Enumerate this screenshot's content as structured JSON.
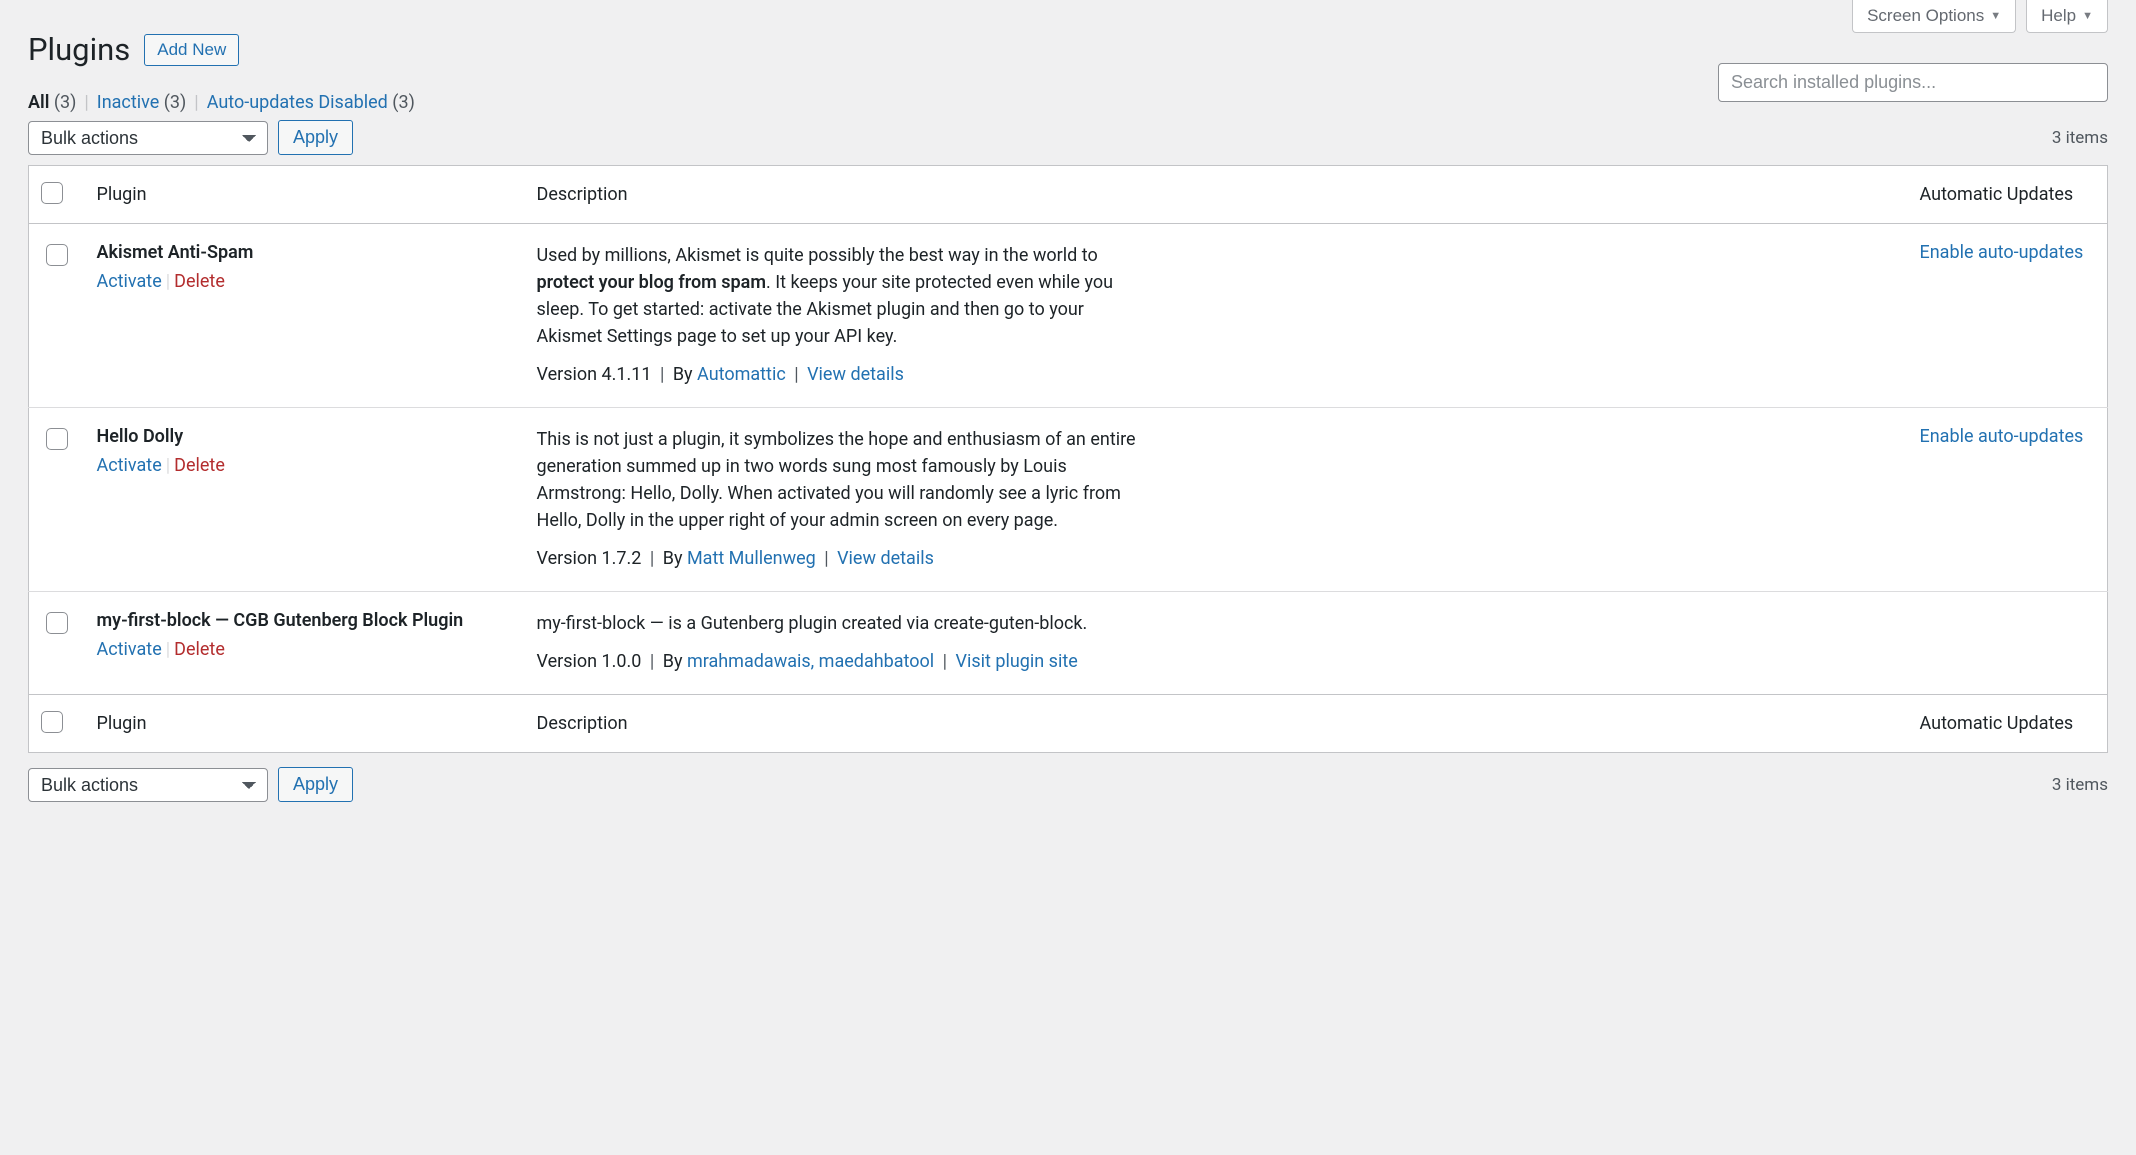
{
  "top_toolbar": {
    "screen_options": "Screen Options",
    "help": "Help"
  },
  "header": {
    "title": "Plugins",
    "add_new": "Add New"
  },
  "filters": {
    "all_label": "All",
    "all_count": "(3)",
    "inactive_label": "Inactive",
    "inactive_count": "(3)",
    "auto_disabled_label": "Auto-updates Disabled",
    "auto_disabled_count": "(3)"
  },
  "search": {
    "placeholder": "Search installed plugins..."
  },
  "bulk": {
    "label": "Bulk actions",
    "apply": "Apply"
  },
  "pagination": {
    "items": "3 items"
  },
  "columns": {
    "plugin": "Plugin",
    "description": "Description",
    "auto_updates": "Automatic Updates"
  },
  "row_labels": {
    "activate": "Activate",
    "delete": "Delete",
    "by": "By",
    "view_details": "View details",
    "visit_plugin_site": "Visit plugin site",
    "enable_auto_updates": "Enable auto-updates"
  },
  "plugins": [
    {
      "name": "Akismet Anti-Spam",
      "desc_pre": "Used by millions, Akismet is quite possibly the best way in the world to ",
      "desc_bold": "protect your blog from spam",
      "desc_post": ". It keeps your site protected even while you sleep. To get started: activate the Akismet plugin and then go to your Akismet Settings page to set up your API key.",
      "version": "Version 4.1.11",
      "author": "Automattic",
      "detail_link": "View details",
      "auto_update": true
    },
    {
      "name": "Hello Dolly",
      "desc_pre": "This is not just a plugin, it symbolizes the hope and enthusiasm of an entire generation summed up in two words sung most famously by Louis Armstrong: Hello, Dolly. When activated you will randomly see a lyric from Hello, Dolly in the upper right of your admin screen on every page.",
      "desc_bold": "",
      "desc_post": "",
      "version": "Version 1.7.2",
      "author": "Matt Mullenweg",
      "detail_link": "View details",
      "auto_update": true
    },
    {
      "name": "my-first-block — CGB Gutenberg Block Plugin",
      "desc_pre": "my-first-block — is a Gutenberg plugin created via create-guten-block.",
      "desc_bold": "",
      "desc_post": "",
      "version": "Version 1.0.0",
      "author": "mrahmadawais, maedahbatool",
      "detail_link": "Visit plugin site",
      "auto_update": false
    }
  ]
}
